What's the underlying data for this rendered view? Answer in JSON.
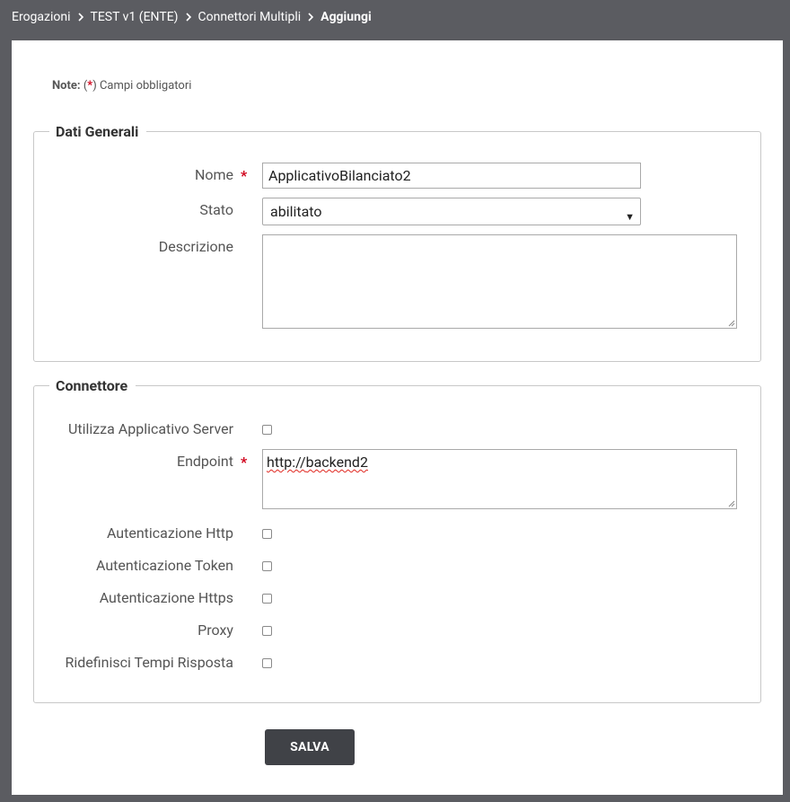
{
  "breadcrumb": {
    "items": [
      "Erogazioni",
      "TEST v1 (ENTE)",
      "Connettori Multipli"
    ],
    "current": "Aggiungi"
  },
  "note": {
    "label": "Note:",
    "open": "(",
    "star": "*",
    "close": ")",
    "text": "Campi obbligatori"
  },
  "dati_generali": {
    "legend": "Dati Generali",
    "nome": {
      "label": "Nome",
      "required": "*",
      "value": "ApplicativoBilanciato2"
    },
    "stato": {
      "label": "Stato",
      "value": "abilitato"
    },
    "descrizione": {
      "label": "Descrizione",
      "value": ""
    }
  },
  "connettore": {
    "legend": "Connettore",
    "applicativo_server": {
      "label": "Utilizza Applicativo Server",
      "checked": false
    },
    "endpoint": {
      "label": "Endpoint",
      "required": "*",
      "prefix": "http://",
      "suffix": "backend2"
    },
    "autenticazione_http": {
      "label": "Autenticazione Http",
      "checked": false
    },
    "autenticazione_token": {
      "label": "Autenticazione Token",
      "checked": false
    },
    "autenticazione_https": {
      "label": "Autenticazione Https",
      "checked": false
    },
    "proxy": {
      "label": "Proxy",
      "checked": false
    },
    "tempi_risposta": {
      "label": "Ridefinisci Tempi Risposta",
      "checked": false
    }
  },
  "actions": {
    "save_label": "SALVA"
  },
  "colors": {
    "background": "#5b5c61",
    "required": "#d0021b",
    "button": "#404247"
  }
}
